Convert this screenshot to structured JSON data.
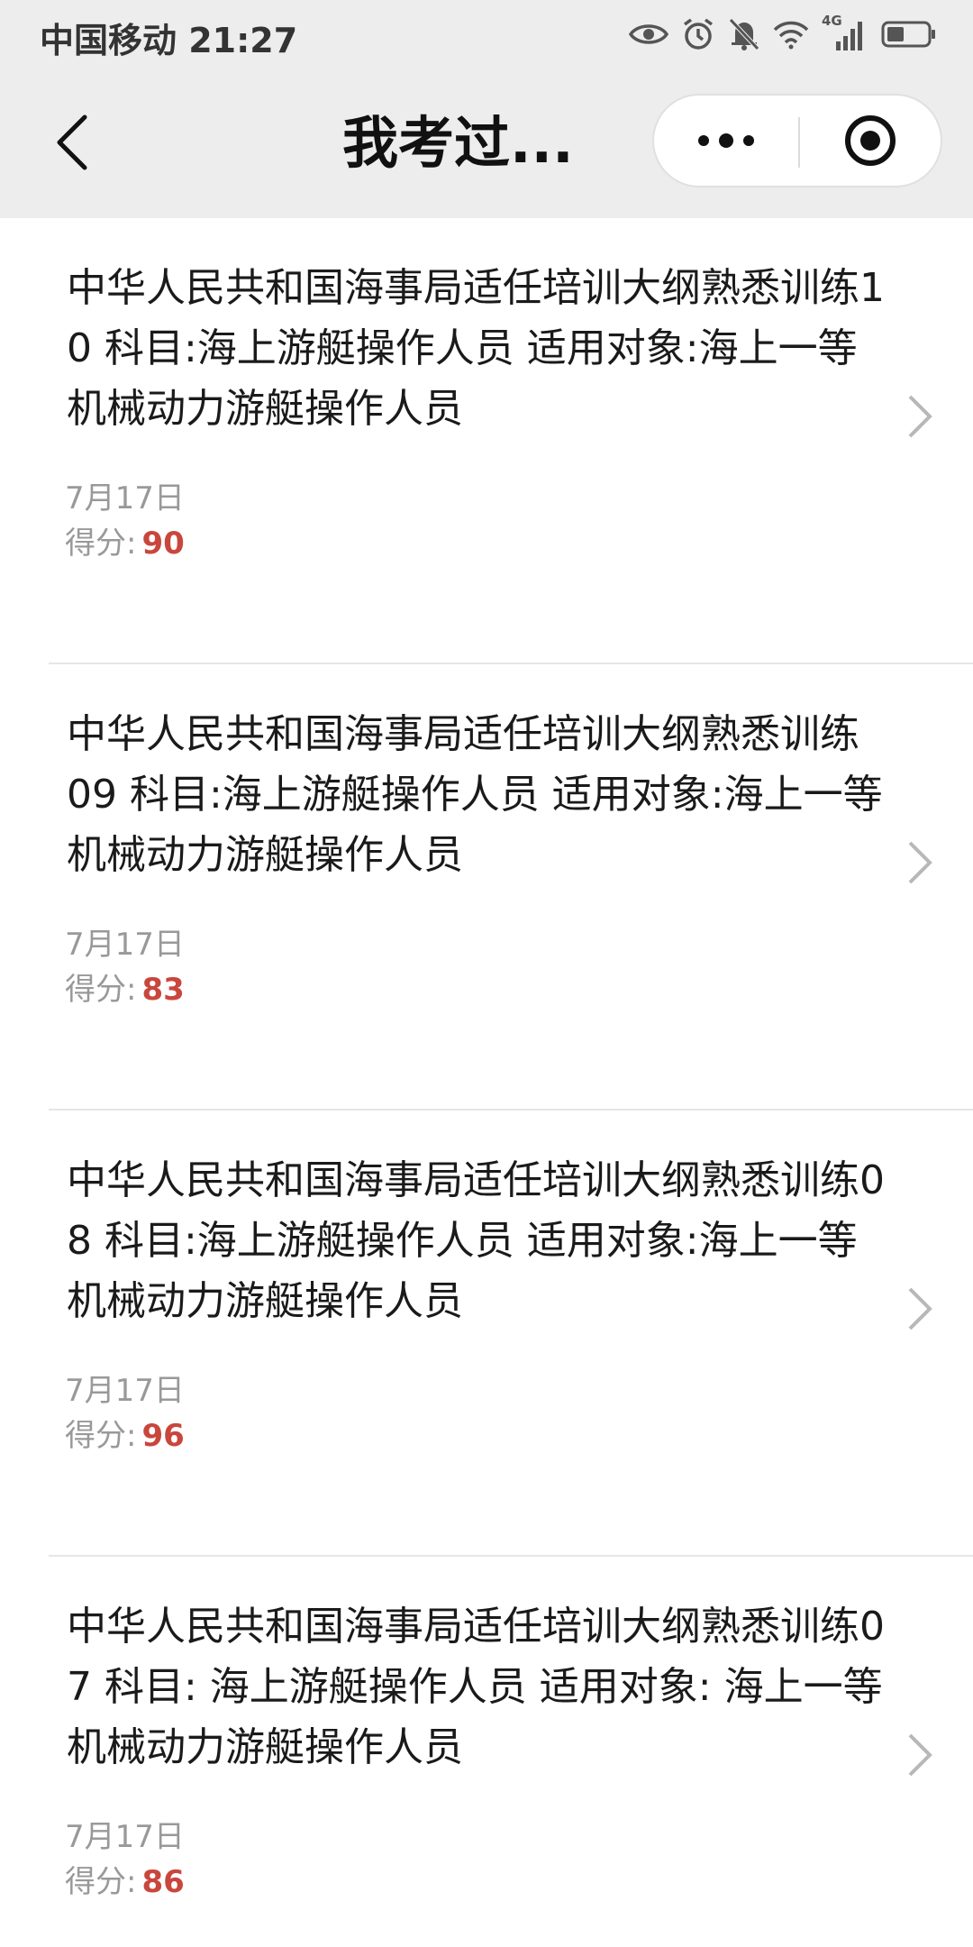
{
  "status_bar": {
    "carrier_time": "中国移动 21:27",
    "network_label": "4G"
  },
  "nav": {
    "title": "我考过..."
  },
  "records": [
    {
      "title": "中华人民共和国海事局适任培训大纲熟悉训练10 科目:海上游艇操作人员 适用对象:海上一等机械动力游艇操作人员",
      "date": "7月17日",
      "score_label": "得分:",
      "score": "90"
    },
    {
      "title": "中华人民共和国海事局适任培训大纲熟悉训练 09 科目:海上游艇操作人员 适用对象:海上一等机械动力游艇操作人员",
      "date": "7月17日",
      "score_label": "得分:",
      "score": "83"
    },
    {
      "title": "中华人民共和国海事局适任培训大纲熟悉训练08 科目:海上游艇操作人员 适用对象:海上一等机械动力游艇操作人员",
      "date": "7月17日",
      "score_label": "得分:",
      "score": "96"
    },
    {
      "title": "中华人民共和国海事局适任培训大纲熟悉训练07 科目: 海上游艇操作人员 适用对象: 海上一等机械动力游艇操作人员",
      "date": "7月17日",
      "score_label": "得分:",
      "score": "86"
    }
  ],
  "colors": {
    "score": "#c9463d",
    "nav_background": "#ededed",
    "meta_text": "#999999"
  },
  "icons": [
    "back-arrow-icon",
    "more-dots-icon",
    "target-icon",
    "chevron-right-icon",
    "eye-icon",
    "alarm-icon",
    "bell-off-icon",
    "wifi-icon",
    "signal-icon",
    "battery-icon"
  ]
}
